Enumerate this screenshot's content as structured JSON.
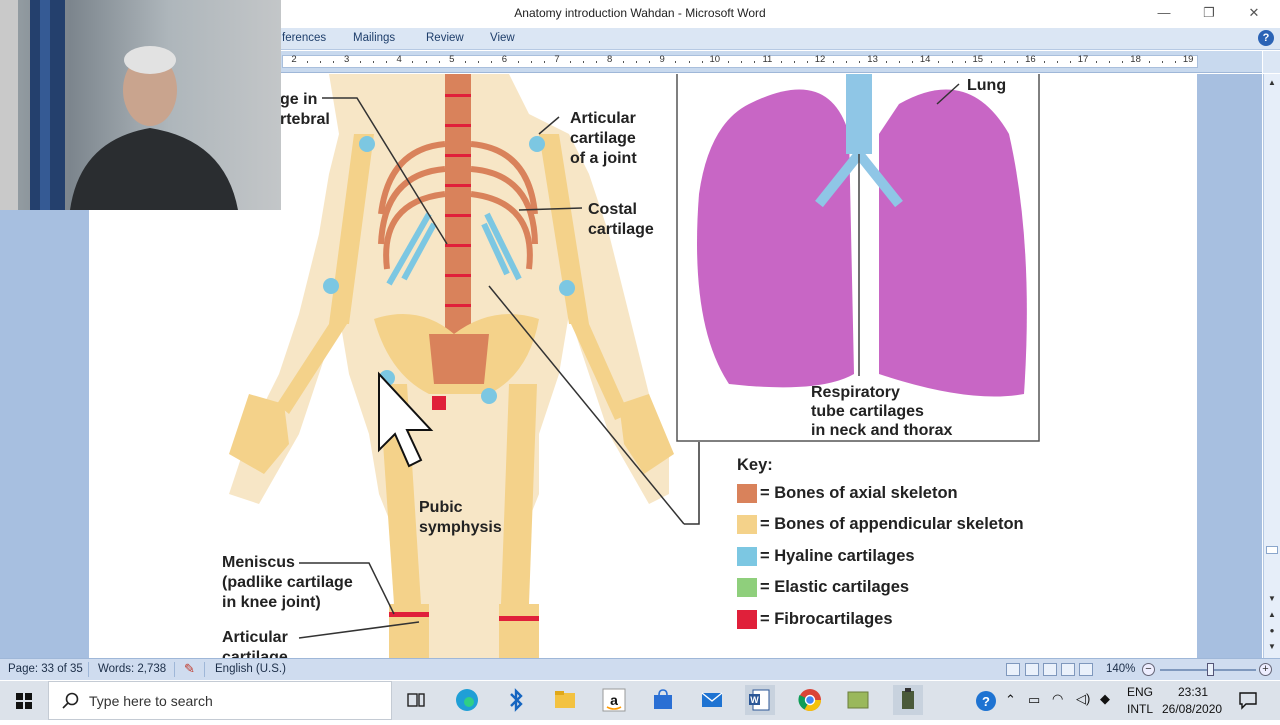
{
  "window": {
    "title": "Anatomy introduction Wahdan - Microsoft Word",
    "minimize": "—",
    "restore": "❐",
    "close": "✕"
  },
  "ribbon": {
    "tabs": [
      "ferences",
      "Mailings",
      "Review",
      "View"
    ],
    "help": "?"
  },
  "ruler": {
    "numbers": [
      "2",
      "3",
      "4",
      "5",
      "6",
      "7",
      "8",
      "9",
      "10",
      "11",
      "12",
      "13",
      "14",
      "15",
      "16",
      "17",
      "18",
      "19"
    ]
  },
  "document": {
    "labels": {
      "vertebral_top": "ge in",
      "vertebral_bottom": "rtebral",
      "articular_joint": [
        "Articular",
        "cartilage",
        "of a joint"
      ],
      "costal": [
        "Costal",
        "cartilage"
      ],
      "lung": "Lung",
      "respiratory": [
        "Respiratory",
        "tube cartilages",
        "in neck and thorax"
      ],
      "pubic": [
        "Pubic",
        "symphysis"
      ],
      "meniscus": [
        "Meniscus",
        "(padlike cartilage",
        "in knee joint)"
      ],
      "articular_bottom": [
        "Articular",
        "cartilage"
      ]
    },
    "key": {
      "title": "Key:",
      "items": [
        {
          "label": "= Bones of axial skeleton",
          "color": "#d9825b"
        },
        {
          "label": "= Bones of appendicular skeleton",
          "color": "#f4d28a"
        },
        {
          "label": "= Hyaline cartilages",
          "color": "#7cc7e2"
        },
        {
          "label": "= Elastic cartilages",
          "color": "#8fcf7c"
        },
        {
          "label": "= Fibrocartilages",
          "color": "#e0203a"
        }
      ]
    }
  },
  "status": {
    "page": "Page: 33 of 35",
    "words": "Words: 2,738",
    "language": "English (U.S.)",
    "zoom": "140%",
    "zoom_minus": "−",
    "zoom_plus": "+"
  },
  "taskbar": {
    "search_placeholder": "Type here to search",
    "lang_top": "ENG",
    "lang_bottom": "INTL",
    "time": "23:31",
    "date": "26/08/2020"
  }
}
